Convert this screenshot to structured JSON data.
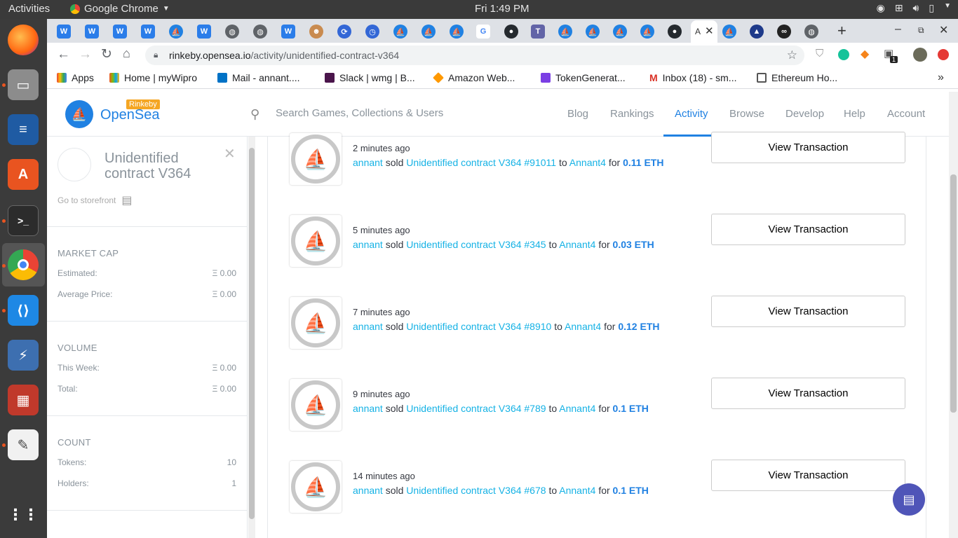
{
  "os": {
    "activities": "Activities",
    "app_name": "Google Chrome",
    "clock": "Fri  1:49 PM"
  },
  "browser": {
    "url_host": "rinkeby.opensea.io",
    "url_path": "/activity/unidentified-contract-v364",
    "active_tab_title": "A",
    "bookmarks": [
      {
        "label": "Apps",
        "color": "#ea4335"
      },
      {
        "label": "Home | myWipro",
        "color": "#0f9d58"
      },
      {
        "label": "Mail - annant....",
        "color": "#0072c6"
      },
      {
        "label": "Slack | wmg | B...",
        "color": "#4a154b"
      },
      {
        "label": "Amazon Web...",
        "color": "#ff9900"
      },
      {
        "label": "TokenGenerat...",
        "color": "#7b3fe4"
      },
      {
        "label": "Inbox (18) - sm...",
        "color": "#d93025"
      },
      {
        "label": "Ethereum Ho...",
        "color": "#555555"
      }
    ],
    "extension_badge": "1"
  },
  "site": {
    "brand": "OpenSea",
    "network_badge": "Rinkeby",
    "search_placeholder": "Search Games, Collections & Users",
    "nav": [
      "Blog",
      "Rankings",
      "Activity",
      "Browse",
      "Develop",
      "Help",
      "Account"
    ],
    "accent": "#2081e2"
  },
  "sidebar": {
    "collection_name": "Unidentified contract V364",
    "storefront_label": "Go to storefront",
    "market_cap": {
      "heading": "MARKET CAP",
      "rows": [
        {
          "label": "Estimated:",
          "value": "Ξ 0.00"
        },
        {
          "label": "Average Price:",
          "value": "Ξ 0.00"
        }
      ]
    },
    "volume": {
      "heading": "VOLUME",
      "rows": [
        {
          "label": "This Week:",
          "value": "Ξ 0.00"
        },
        {
          "label": "Total:",
          "value": "Ξ 0.00"
        }
      ]
    },
    "count": {
      "heading": "COUNT",
      "rows": [
        {
          "label": "Tokens:",
          "value": "10"
        },
        {
          "label": "Holders:",
          "value": "1"
        }
      ]
    }
  },
  "activity": [
    {
      "time": "2 minutes ago",
      "seller": "annant",
      "verb": "sold",
      "item": "Unidentified contract V364 #91011",
      "to": "to",
      "buyer": "Annant4",
      "for": "for",
      "price": "0.11 ETH",
      "button": "View Transaction"
    },
    {
      "time": "5 minutes ago",
      "seller": "annant",
      "verb": "sold",
      "item": "Unidentified contract V364 #345",
      "to": "to",
      "buyer": "Annant4",
      "for": "for",
      "price": "0.03 ETH",
      "button": "View Transaction"
    },
    {
      "time": "7 minutes ago",
      "seller": "annant",
      "verb": "sold",
      "item": "Unidentified contract V364 #8910",
      "to": "to",
      "buyer": "Annant4",
      "for": "for",
      "price": "0.12 ETH",
      "button": "View Transaction"
    },
    {
      "time": "9 minutes ago",
      "seller": "annant",
      "verb": "sold",
      "item": "Unidentified contract V364 #789",
      "to": "to",
      "buyer": "Annant4",
      "for": "for",
      "price": "0.1 ETH",
      "button": "View Transaction"
    },
    {
      "time": "14 minutes ago",
      "seller": "annant",
      "verb": "sold",
      "item": "Unidentified contract V364 #678",
      "to": "to",
      "buyer": "Annant4",
      "for": "for",
      "price": "0.1 ETH",
      "button": "View Transaction"
    }
  ]
}
